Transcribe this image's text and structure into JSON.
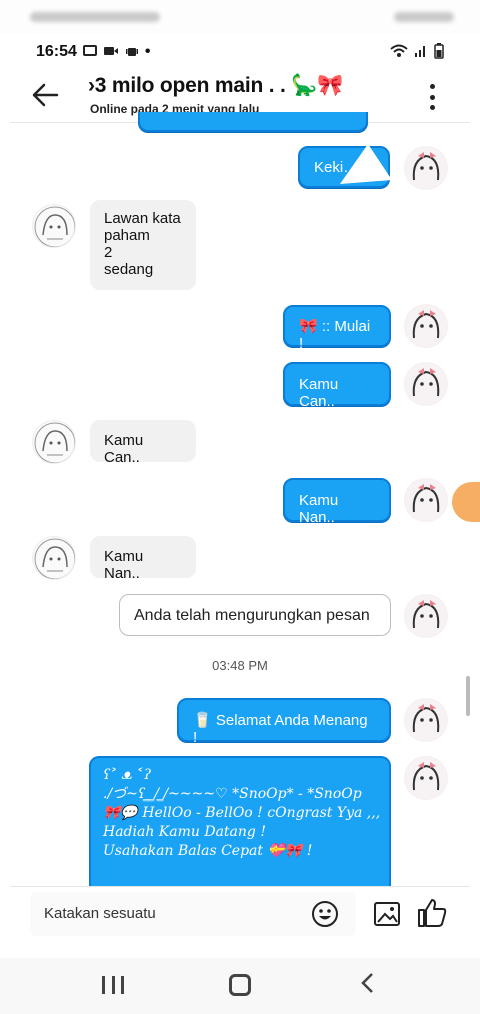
{
  "status_bar": {
    "time": "16:54",
    "left_icons": [
      "chat-icon",
      "camera-icon",
      "android-icon"
    ],
    "dot": "•",
    "right_icons": [
      "wifi-icon",
      "signal-icon",
      "battery-icon"
    ]
  },
  "header": {
    "title": "›3 milo open main . . 🦕🎀",
    "subtitle": "Online pada 2 menit yang lalu"
  },
  "messages": [
    {
      "side": "out",
      "text": "Keki…"
    },
    {
      "side": "in",
      "lines": [
        "Lawan kata",
        "paham",
        "2",
        "sedang"
      ]
    },
    {
      "side": "out",
      "text": "🎀 :: Mulai !"
    },
    {
      "side": "out",
      "text": "Kamu Can.."
    },
    {
      "side": "in",
      "text": "Kamu Can.."
    },
    {
      "side": "out",
      "text": "Kamu Nan.."
    },
    {
      "side": "in",
      "text": "Kamu Nan.."
    },
    {
      "side": "out",
      "text": "Anda telah mengurungkan pesan",
      "variant": "unsent"
    },
    {
      "side": "out",
      "text": "🥛 Selamat Anda Menang !"
    },
    {
      "side": "out",
      "lines": [
        "ʕ˃ ᴥ ˂ʔ",
        "./づ~ʕ ̳ ̳/ ̳/~~~~♡ *SnoOp* - *SnoOp",
        "🎀💬 HellOo - BellOo ! cOngrast Yya ,,,",
        "Hadiah Kamu Datang !",
        "Usahakan Balas Cepat 💝🎀 !"
      ]
    }
  ],
  "timestamp": "03:48 PM",
  "composer": {
    "placeholder": "Katakan sesuatu"
  },
  "colors": {
    "outgoing_bubble": "#1aa3f5",
    "outgoing_border": "#0b7dd6",
    "incoming_bubble": "#f1f1f1"
  }
}
